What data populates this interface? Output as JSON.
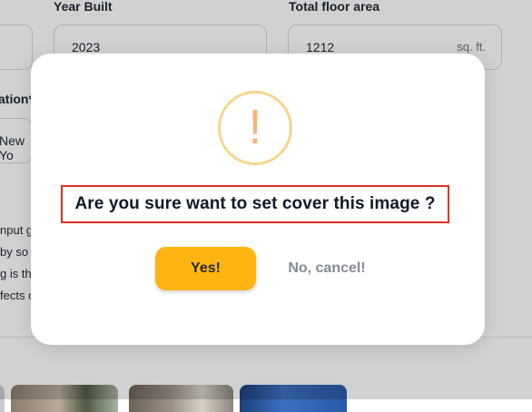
{
  "form": {
    "year_built": {
      "label": "Year Built",
      "value": "2023"
    },
    "floor_area": {
      "label": "Total floor area",
      "value": "1212",
      "unit": "sq. ft."
    },
    "location": {
      "label": "ation*",
      "value": "New Yo"
    },
    "description_lines": [
      "nput g",
      "by so",
      "g is th",
      "fects o"
    ]
  },
  "dialog": {
    "icon": "exclamation-icon",
    "icon_glyph": "!",
    "message": "Are you sure want to set cover this image ?",
    "confirm_label": "Yes!",
    "cancel_label": "No, cancel!"
  },
  "colors": {
    "accent": "#ffb411",
    "icon_ring": "#f5d48c",
    "icon_glyph": "#f7b37a",
    "highlight_border": "#e0301e",
    "cancel_text": "#858a93"
  }
}
